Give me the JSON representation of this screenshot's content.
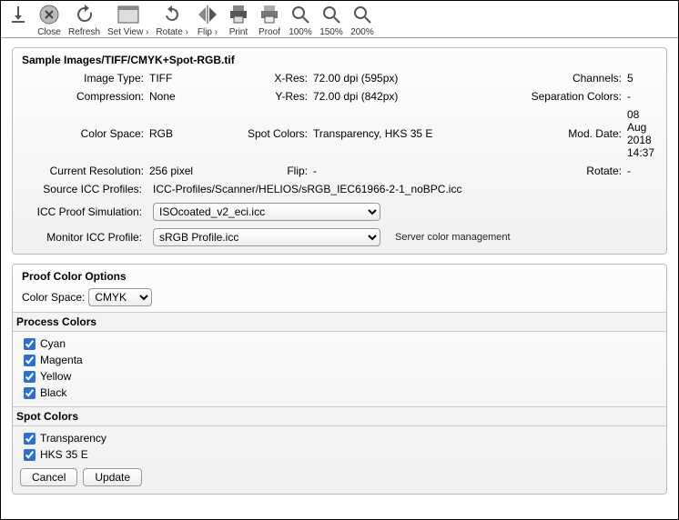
{
  "toolbar": {
    "close": "Close",
    "refresh": "Refresh",
    "setview": "Set View ›",
    "rotate": "Rotate ›",
    "flip": "Flip ›",
    "print": "Print",
    "proof": "Proof",
    "zoom100": "100%",
    "zoom150": "150%",
    "zoom200": "200%"
  },
  "file": {
    "title": "Sample Images/TIFF/CMYK+Spot-RGB.tif",
    "labels": {
      "image_type": "Image Type:",
      "compression": "Compression:",
      "color_space": "Color Space:",
      "cur_res": "Current Resolution:",
      "src_icc": "Source ICC Profiles:",
      "xres": "X-Res:",
      "yres": "Y-Res:",
      "spot_colors": "Spot Colors:",
      "flip": "Flip:",
      "channels": "Channels:",
      "sep_colors": "Separation Colors:",
      "mod_date": "Mod. Date:",
      "rotate": "Rotate:",
      "icc_proof": "ICC Proof Simulation:",
      "monitor_icc": "Monitor ICC Profile:"
    },
    "values": {
      "image_type": "TIFF",
      "compression": "None",
      "color_space": "RGB",
      "cur_res": "256 pixel",
      "src_icc": "ICC-Profiles/Scanner/HELIOS/sRGB_IEC61966-2-1_noBPC.icc",
      "xres": "72.00 dpi (595px)",
      "yres": "72.00 dpi (842px)",
      "spot_colors": "Transparency, HKS 35 E",
      "flip": "-",
      "channels": "5",
      "sep_colors": "-",
      "mod_date": "08 Aug 2018 14:37",
      "rotate": "-"
    },
    "icc_proof_value": "ISOcoated_v2_eci.icc",
    "monitor_icc_value": "sRGB Profile.icc",
    "server_note": "Server color management"
  },
  "proof": {
    "panel_title": "Proof Color Options",
    "color_space_label": "Color Space:",
    "color_space_value": "CMYK",
    "process_title": "Process Colors",
    "process_colors": [
      "Cyan",
      "Magenta",
      "Yellow",
      "Black"
    ],
    "spot_title": "Spot Colors",
    "spot_colors": [
      "Transparency",
      "HKS 35 E"
    ],
    "cancel": "Cancel",
    "update": "Update"
  }
}
